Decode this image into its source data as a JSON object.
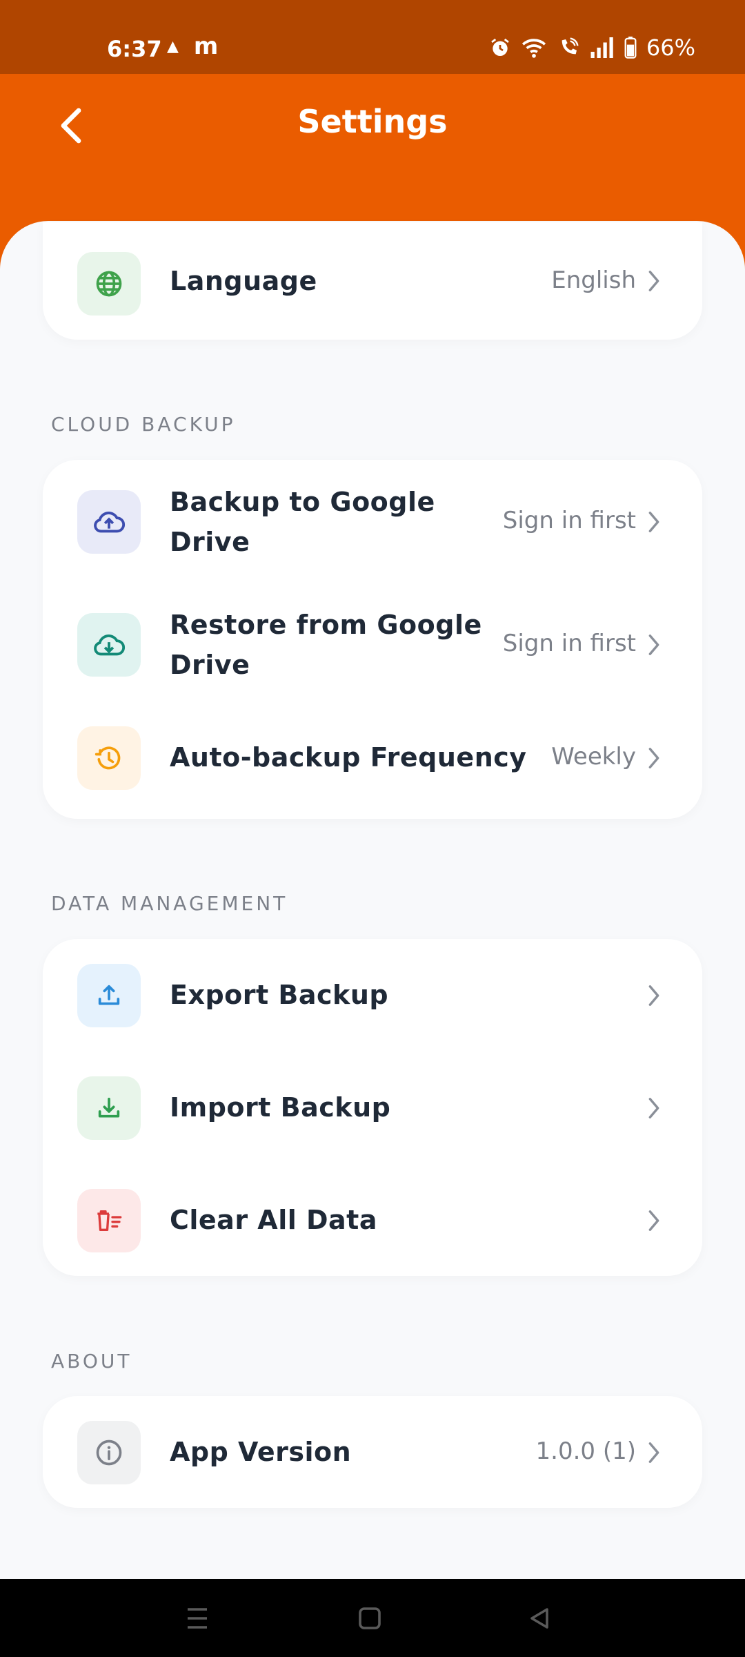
{
  "status_bar": {
    "time": "6:37",
    "battery": "66%",
    "icons": [
      "warning-triangle-icon",
      "m-app-icon",
      "alarm-icon",
      "wifi-icon",
      "wifi-calling-icon",
      "signal-icon",
      "battery-icon"
    ]
  },
  "header": {
    "title": "Settings",
    "back_icon": "chevron-left-icon"
  },
  "colors": {
    "status_bar": "#B04500",
    "header": "#EA5C00",
    "background": "#F8F9FB"
  },
  "language_row": {
    "label": "Language",
    "value": "English",
    "icon": "globe-icon"
  },
  "cloud_backup": {
    "section_label": "CLOUD BACKUP",
    "items": [
      {
        "label_line1": "Backup to Google",
        "label_line2": "Drive",
        "value": "Sign in first",
        "icon": "cloud-upload-icon"
      },
      {
        "label_line1": "Restore from Google",
        "label_line2": "Drive",
        "value": "Sign in first",
        "icon": "cloud-download-icon"
      },
      {
        "label": "Auto-backup Frequency",
        "value": "Weekly",
        "icon": "history-clock-icon"
      }
    ]
  },
  "data_management": {
    "section_label": "DATA MANAGEMENT",
    "items": [
      {
        "label": "Export Backup",
        "icon": "upload-icon"
      },
      {
        "label": "Import Backup",
        "icon": "download-icon"
      },
      {
        "label": "Clear All Data",
        "icon": "delete-sweep-icon"
      }
    ]
  },
  "about": {
    "section_label": "ABOUT",
    "items": [
      {
        "label": "App Version",
        "value": "1.0.0 (1)",
        "icon": "info-icon"
      }
    ]
  },
  "nav_bar": {
    "icons": [
      "recents-icon",
      "home-icon",
      "back-icon"
    ]
  }
}
